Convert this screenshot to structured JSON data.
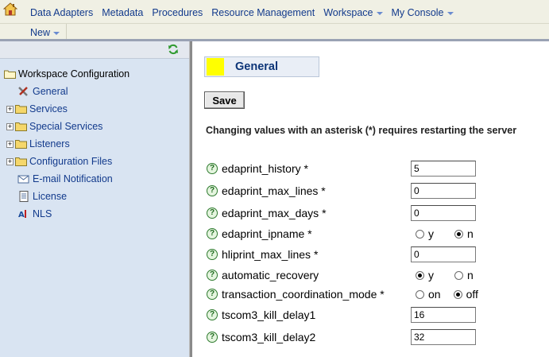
{
  "menu": {
    "items": [
      {
        "label": "Data Adapters",
        "dropdown": false
      },
      {
        "label": "Metadata",
        "dropdown": false
      },
      {
        "label": "Procedures",
        "dropdown": false
      },
      {
        "label": "Resource Management",
        "dropdown": false
      },
      {
        "label": "Workspace",
        "dropdown": true
      },
      {
        "label": "My Console",
        "dropdown": true
      }
    ],
    "new_label": "New"
  },
  "sidebar": {
    "root": "Workspace Configuration",
    "items": [
      {
        "label": "General",
        "icon": "tools-icon",
        "expandable": false
      },
      {
        "label": "Services",
        "icon": "folder-icon",
        "expandable": true
      },
      {
        "label": "Special Services",
        "icon": "folder-icon",
        "expandable": true
      },
      {
        "label": "Listeners",
        "icon": "folder-icon",
        "expandable": true
      },
      {
        "label": "Configuration Files",
        "icon": "folder-icon",
        "expandable": true
      },
      {
        "label": "E-mail Notification",
        "icon": "email-icon",
        "expandable": false
      },
      {
        "label": "License",
        "icon": "document-icon",
        "expandable": false
      },
      {
        "label": "NLS",
        "icon": "language-icon",
        "expandable": false
      }
    ]
  },
  "main": {
    "title": "General",
    "save_label": "Save",
    "notice": "Changing values with an asterisk (*) requires restarting the server",
    "properties": [
      {
        "label": "edaprint_history *",
        "type": "text",
        "value": "5"
      },
      {
        "label": "edaprint_max_lines *",
        "type": "text",
        "value": "0"
      },
      {
        "label": "edaprint_max_days *",
        "type": "text",
        "value": "0"
      },
      {
        "label": "edaprint_ipname *",
        "type": "radio",
        "options": [
          "y",
          "n"
        ],
        "selected": "n"
      },
      {
        "label": "hliprint_max_lines *",
        "type": "text",
        "value": "0"
      },
      {
        "label": "automatic_recovery",
        "type": "radio",
        "options": [
          "y",
          "n"
        ],
        "selected": "y"
      },
      {
        "label": "transaction_coordination_mode *",
        "type": "radio",
        "options": [
          "on",
          "off"
        ],
        "selected": "off"
      },
      {
        "label": "tscom3_kill_delay1",
        "type": "text",
        "value": "16"
      },
      {
        "label": "tscom3_kill_delay2",
        "type": "text",
        "value": "32"
      }
    ]
  },
  "colors": {
    "link": "#123a8c",
    "title_swatch": "#ffff00",
    "sidebar_bg": "#d9e4f2",
    "toolbar_bg": "#f0f0e4"
  }
}
